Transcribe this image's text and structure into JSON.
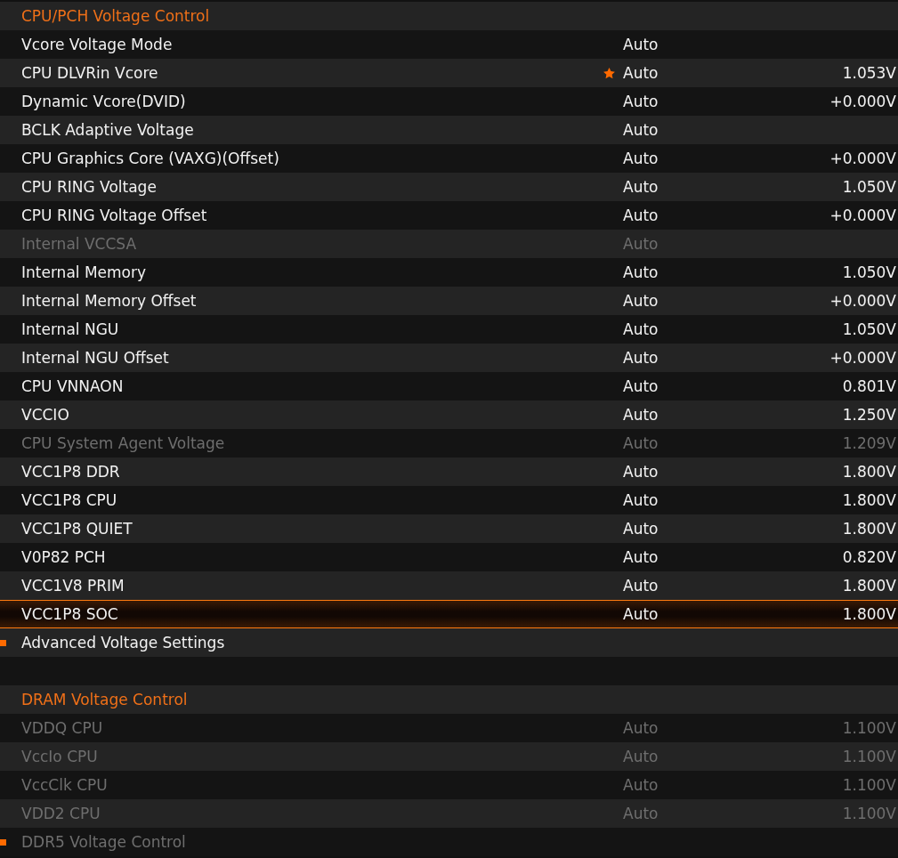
{
  "rows": [
    {
      "kind": "header",
      "label": "CPU/PCH Voltage Control"
    },
    {
      "kind": "setting",
      "label": "Vcore Voltage Mode",
      "value": "Auto",
      "disabled": false,
      "starred": false,
      "selected": false
    },
    {
      "kind": "setting",
      "label": "CPU DLVRin Vcore",
      "value": "Auto",
      "reading": "1.053V",
      "disabled": false,
      "starred": true,
      "selected": false
    },
    {
      "kind": "setting",
      "label": "Dynamic Vcore(DVID)",
      "value": "Auto",
      "reading": "+0.000V",
      "disabled": false,
      "starred": false,
      "selected": false
    },
    {
      "kind": "setting",
      "label": "BCLK Adaptive Voltage",
      "value": "Auto",
      "disabled": false,
      "starred": false,
      "selected": false
    },
    {
      "kind": "setting",
      "label": "CPU Graphics Core (VAXG)(Offset)",
      "value": "Auto",
      "reading": "+0.000V",
      "disabled": false,
      "starred": false,
      "selected": false
    },
    {
      "kind": "setting",
      "label": "CPU RING Voltage",
      "value": "Auto",
      "reading": "1.050V",
      "disabled": false,
      "starred": false,
      "selected": false
    },
    {
      "kind": "setting",
      "label": "CPU RING Voltage Offset",
      "value": "Auto",
      "reading": "+0.000V",
      "disabled": false,
      "starred": false,
      "selected": false
    },
    {
      "kind": "setting",
      "label": "Internal VCCSA",
      "value": "Auto",
      "disabled": true,
      "starred": false,
      "selected": false
    },
    {
      "kind": "setting",
      "label": "Internal Memory",
      "value": "Auto",
      "reading": "1.050V",
      "disabled": false,
      "starred": false,
      "selected": false
    },
    {
      "kind": "setting",
      "label": "Internal Memory Offset",
      "value": "Auto",
      "reading": "+0.000V",
      "disabled": false,
      "starred": false,
      "selected": false
    },
    {
      "kind": "setting",
      "label": "Internal NGU",
      "value": "Auto",
      "reading": "1.050V",
      "disabled": false,
      "starred": false,
      "selected": false
    },
    {
      "kind": "setting",
      "label": "Internal NGU Offset",
      "value": "Auto",
      "reading": "+0.000V",
      "disabled": false,
      "starred": false,
      "selected": false
    },
    {
      "kind": "setting",
      "label": "CPU VNNAON",
      "value": "Auto",
      "reading": "0.801V",
      "disabled": false,
      "starred": false,
      "selected": false
    },
    {
      "kind": "setting",
      "label": "VCCIO",
      "value": "Auto",
      "reading": "1.250V",
      "disabled": false,
      "starred": false,
      "selected": false
    },
    {
      "kind": "setting",
      "label": "CPU System Agent Voltage",
      "value": "Auto",
      "reading": "1.209V",
      "disabled": true,
      "starred": false,
      "selected": false
    },
    {
      "kind": "setting",
      "label": "VCC1P8 DDR",
      "value": "Auto",
      "reading": "1.800V",
      "disabled": false,
      "starred": false,
      "selected": false
    },
    {
      "kind": "setting",
      "label": "VCC1P8 CPU",
      "value": "Auto",
      "reading": "1.800V",
      "disabled": false,
      "starred": false,
      "selected": false
    },
    {
      "kind": "setting",
      "label": "VCC1P8 QUIET",
      "value": "Auto",
      "reading": "1.800V",
      "disabled": false,
      "starred": false,
      "selected": false
    },
    {
      "kind": "setting",
      "label": "V0P82 PCH",
      "value": "Auto",
      "reading": "0.820V",
      "disabled": false,
      "starred": false,
      "selected": false
    },
    {
      "kind": "setting",
      "label": "VCC1V8 PRIM",
      "value": "Auto",
      "reading": "1.800V",
      "disabled": false,
      "starred": false,
      "selected": false
    },
    {
      "kind": "setting",
      "label": "VCC1P8 SOC",
      "value": "Auto",
      "reading": "1.800V",
      "disabled": false,
      "starred": false,
      "selected": true
    },
    {
      "kind": "submenu",
      "label": "Advanced Voltage Settings",
      "disabled": false
    },
    {
      "kind": "spacer"
    },
    {
      "kind": "header",
      "label": "DRAM Voltage Control"
    },
    {
      "kind": "setting",
      "label": "VDDQ CPU",
      "value": "Auto",
      "reading": "1.100V",
      "disabled": true,
      "starred": false,
      "selected": false
    },
    {
      "kind": "setting",
      "label": "VccIo CPU",
      "value": "Auto",
      "reading": "1.100V",
      "disabled": true,
      "starred": false,
      "selected": false
    },
    {
      "kind": "setting",
      "label": "VccClk CPU",
      "value": "Auto",
      "reading": "1.100V",
      "disabled": true,
      "starred": false,
      "selected": false
    },
    {
      "kind": "setting",
      "label": "VDD2 CPU",
      "value": "Auto",
      "reading": "1.100V",
      "disabled": true,
      "starred": false,
      "selected": false
    },
    {
      "kind": "submenu",
      "label": "DDR5 Voltage Control",
      "disabled": true
    }
  ]
}
